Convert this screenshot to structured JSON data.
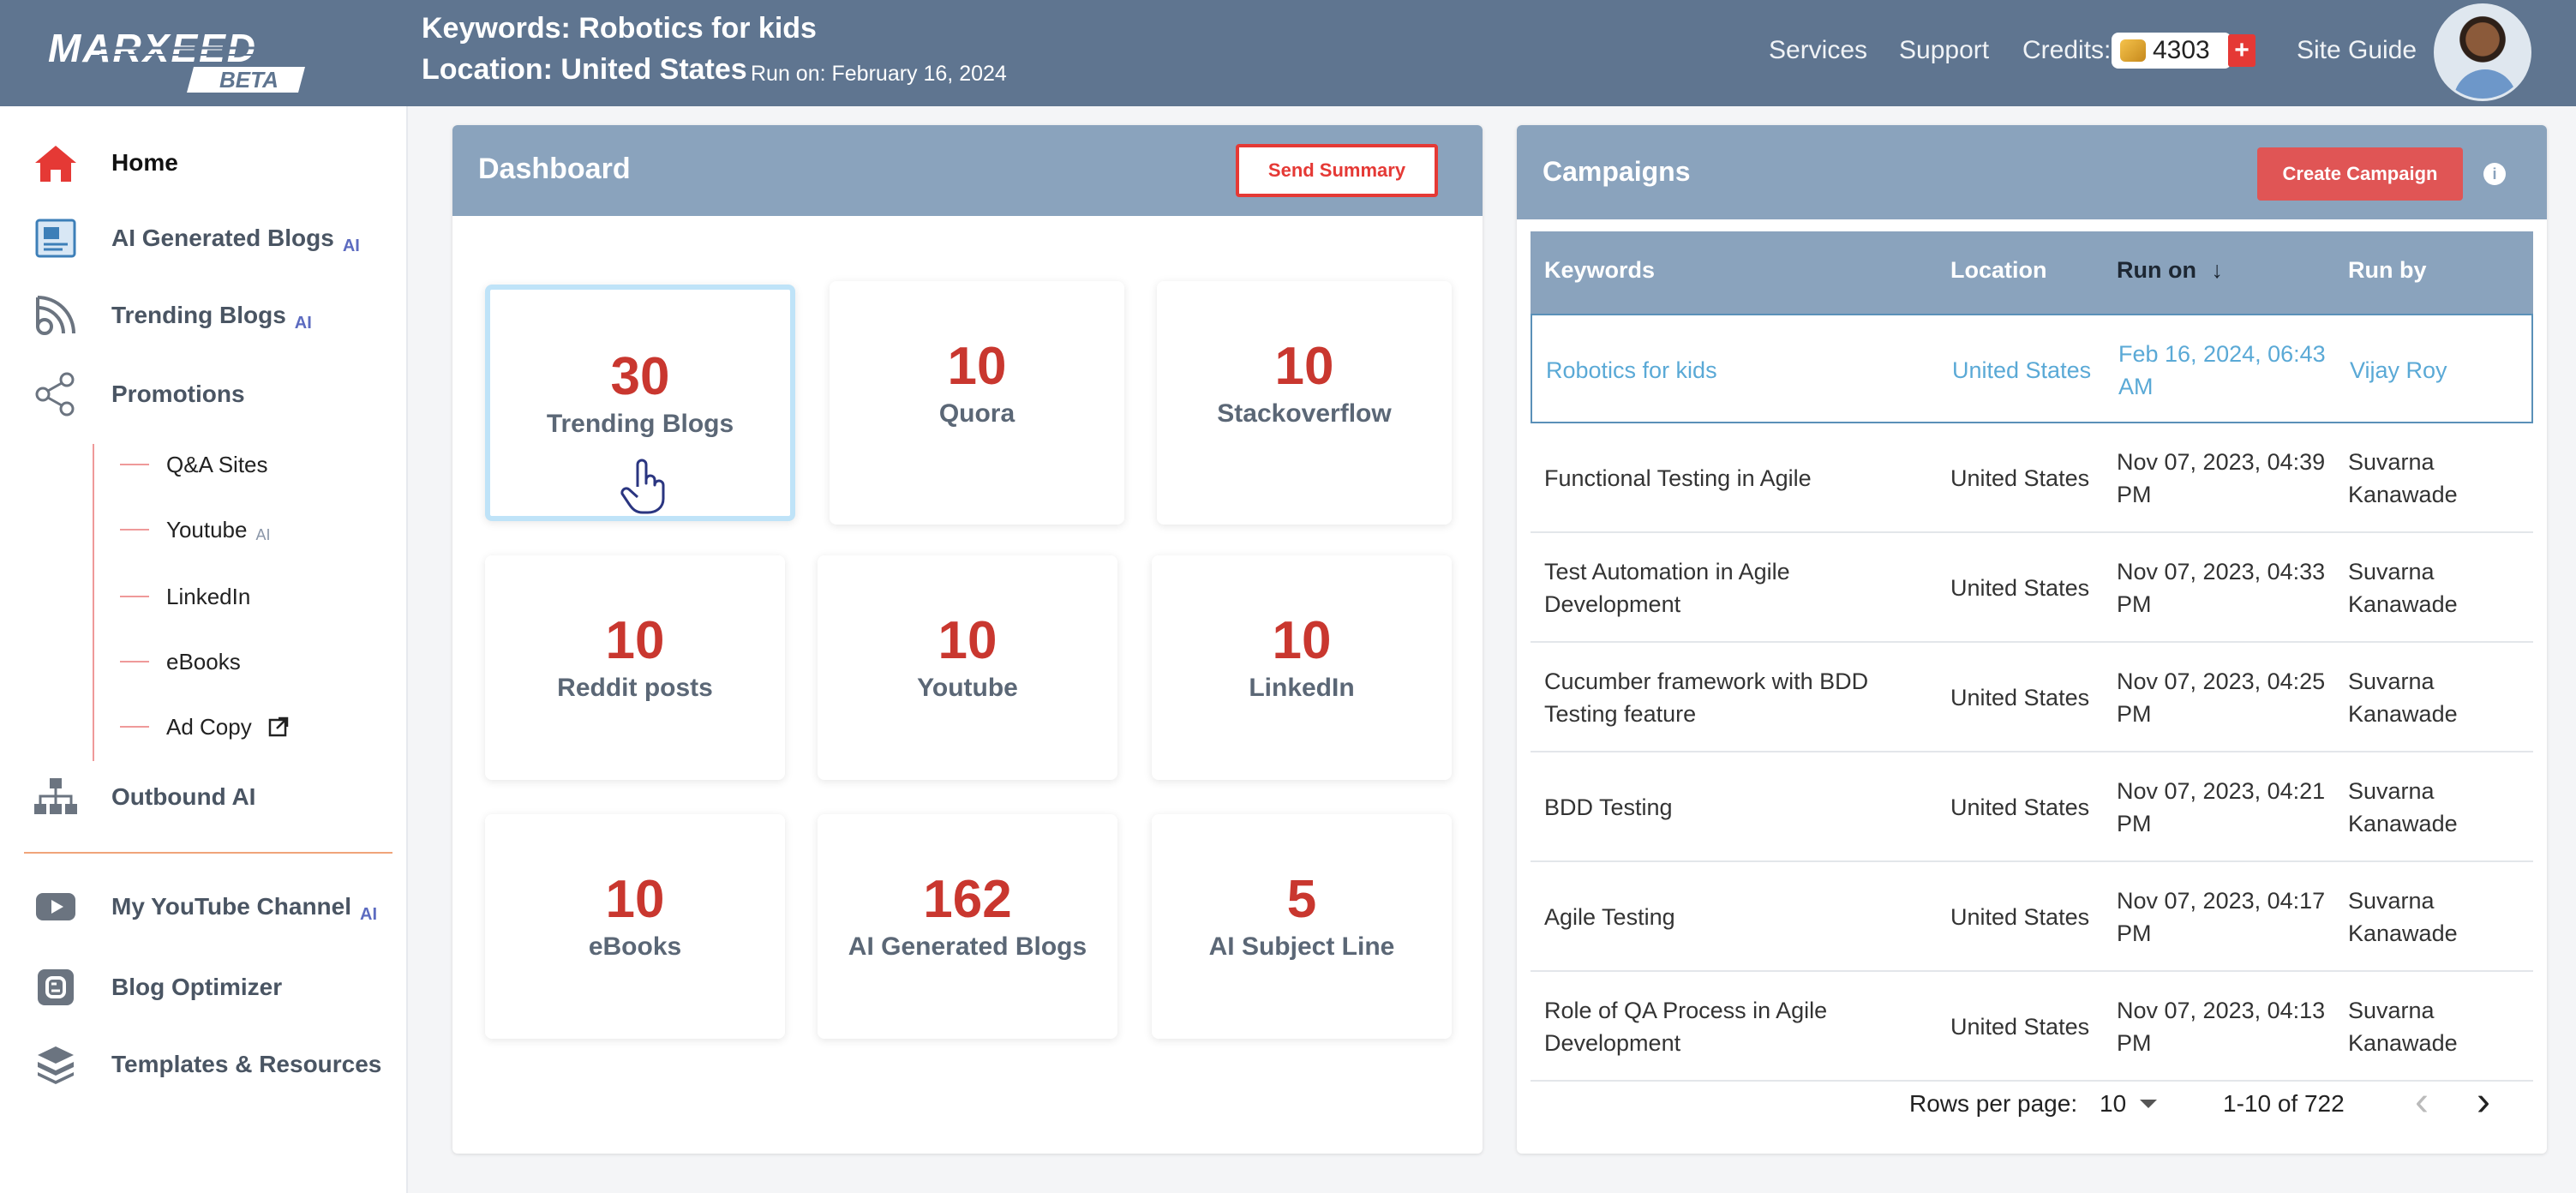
{
  "header": {
    "logo_text": "MARXEED",
    "logo_badge": "BETA",
    "keywords": "Keywords: Robotics for kids",
    "location": "Location: United States",
    "run_on": "Run on: February 16, 2024",
    "nav": {
      "services": "Services",
      "support": "Support",
      "credits_label": "Credits:",
      "credits_value": "4303",
      "plus": "+",
      "site_guide": "Site Guide"
    }
  },
  "sidebar": {
    "items": [
      {
        "label": "Home",
        "icon": "home-icon"
      },
      {
        "label": "AI Generated Blogs",
        "ai": "AI",
        "icon": "blog-doc-icon"
      },
      {
        "label": "Trending Blogs",
        "ai": "AI",
        "icon": "rss-icon"
      },
      {
        "label": "Promotions",
        "icon": "share-icon"
      },
      {
        "label": "Outbound AI",
        "icon": "org-chart-icon"
      },
      {
        "label": "My YouTube Channel",
        "ai": "AI",
        "icon": "youtube-icon"
      },
      {
        "label": "Blog Optimizer",
        "icon": "blogger-icon"
      },
      {
        "label": "Templates & Resources",
        "icon": "layers-icon"
      }
    ],
    "sub_items": [
      {
        "label": "Q&A Sites"
      },
      {
        "label": "Youtube",
        "ai": "AI"
      },
      {
        "label": "LinkedIn"
      },
      {
        "label": "eBooks"
      },
      {
        "label": "Ad Copy",
        "icon": "external-link-icon"
      }
    ]
  },
  "dashboard": {
    "title": "Dashboard",
    "send_summary": "Send Summary",
    "cards": [
      {
        "value": "30",
        "label": "Trending Blogs"
      },
      {
        "value": "10",
        "label": "Quora"
      },
      {
        "value": "10",
        "label": "Stackoverflow"
      },
      {
        "value": "10",
        "label": "Reddit posts"
      },
      {
        "value": "10",
        "label": "Youtube"
      },
      {
        "value": "10",
        "label": "LinkedIn"
      },
      {
        "value": "10",
        "label": "eBooks"
      },
      {
        "value": "162",
        "label": "AI Generated Blogs"
      },
      {
        "value": "5",
        "label": "AI Subject Line"
      }
    ]
  },
  "campaigns": {
    "title": "Campaigns",
    "create_button": "Create Campaign",
    "columns": [
      "Keywords",
      "Location",
      "Run on",
      "Run by"
    ],
    "sort_indicator": "↓",
    "rows": [
      {
        "keywords": [
          "Robotics for kids"
        ],
        "location": "United States",
        "run_on": [
          "Feb 16, 2024, 06:43",
          "AM"
        ],
        "run_by": [
          "Vijay Roy"
        ]
      },
      {
        "keywords": [
          "Functional Testing in Agile"
        ],
        "location": "United States",
        "run_on": [
          "Nov 07, 2023, 04:39",
          "PM"
        ],
        "run_by": [
          "Suvarna",
          "Kanawade"
        ]
      },
      {
        "keywords": [
          "Test Automation in Agile",
          "Development"
        ],
        "location": "United States",
        "run_on": [
          "Nov 07, 2023, 04:33",
          "PM"
        ],
        "run_by": [
          "Suvarna",
          "Kanawade"
        ]
      },
      {
        "keywords": [
          "Cucumber framework with BDD",
          "Testing feature"
        ],
        "location": "United States",
        "run_on": [
          "Nov 07, 2023, 04:25",
          "PM"
        ],
        "run_by": [
          "Suvarna",
          "Kanawade"
        ]
      },
      {
        "keywords": [
          "BDD Testing"
        ],
        "location": "United States",
        "run_on": [
          "Nov 07, 2023, 04:21",
          "PM"
        ],
        "run_by": [
          "Suvarna",
          "Kanawade"
        ]
      },
      {
        "keywords": [
          "Agile Testing"
        ],
        "location": "United States",
        "run_on": [
          "Nov 07, 2023, 04:17",
          "PM"
        ],
        "run_by": [
          "Suvarna",
          "Kanawade"
        ]
      },
      {
        "keywords": [
          "Role of QA Process in Agile",
          "Development"
        ],
        "location": "United States",
        "run_on": [
          "Nov 07, 2023, 04:13",
          "PM"
        ],
        "run_by": [
          "Suvarna",
          "Kanawade"
        ]
      }
    ],
    "footer": {
      "rows_per_page_label": "Rows per page:",
      "rows_per_page_value": "10",
      "range": "1-10 of 722",
      "prev": "‹",
      "next": "›"
    }
  },
  "colors": {
    "header_bg": "#5f7590",
    "panel_head": "#8aa3bd",
    "accent_red": "#c9372f",
    "button_red": "#e05555"
  }
}
